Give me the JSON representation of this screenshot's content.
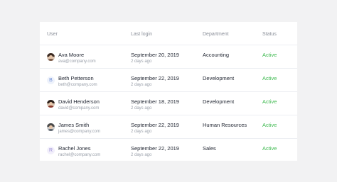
{
  "table": {
    "headers": {
      "user": "User",
      "last_login": "Last login",
      "department": "Department",
      "status": "Status"
    },
    "rows": [
      {
        "name": "Ava Moore",
        "email": "ava@company.com",
        "last_login": "September 20, 2019",
        "ago": "2 days ago",
        "department": "Accounting",
        "status": "Active",
        "avatar": "photo"
      },
      {
        "name": "Beth Petterson",
        "email": "beth@company.com",
        "last_login": "September 22, 2019",
        "ago": "2 days ago",
        "department": "Development",
        "status": "Active",
        "avatar": "letter",
        "avatar_letter": "B"
      },
      {
        "name": "David Henderson",
        "email": "david@company.com",
        "last_login": "September 18, 2019",
        "ago": "2 days ago",
        "department": "Development",
        "status": "Active",
        "avatar": "photo"
      },
      {
        "name": "James Smith",
        "email": "james@company.com",
        "last_login": "September 22, 2019",
        "ago": "2 days ago",
        "department": "Human Resources",
        "status": "Active",
        "avatar": "photo"
      },
      {
        "name": "Rachel Jones",
        "email": "rachel@company.com",
        "last_login": "September 22, 2019",
        "ago": "2 days ago",
        "department": "Sales",
        "status": "Active",
        "avatar": "letter",
        "avatar_letter": "R"
      }
    ]
  },
  "colors": {
    "status_active": "#3cb94e",
    "background": "#f2f2f3",
    "card": "#ffffff"
  }
}
